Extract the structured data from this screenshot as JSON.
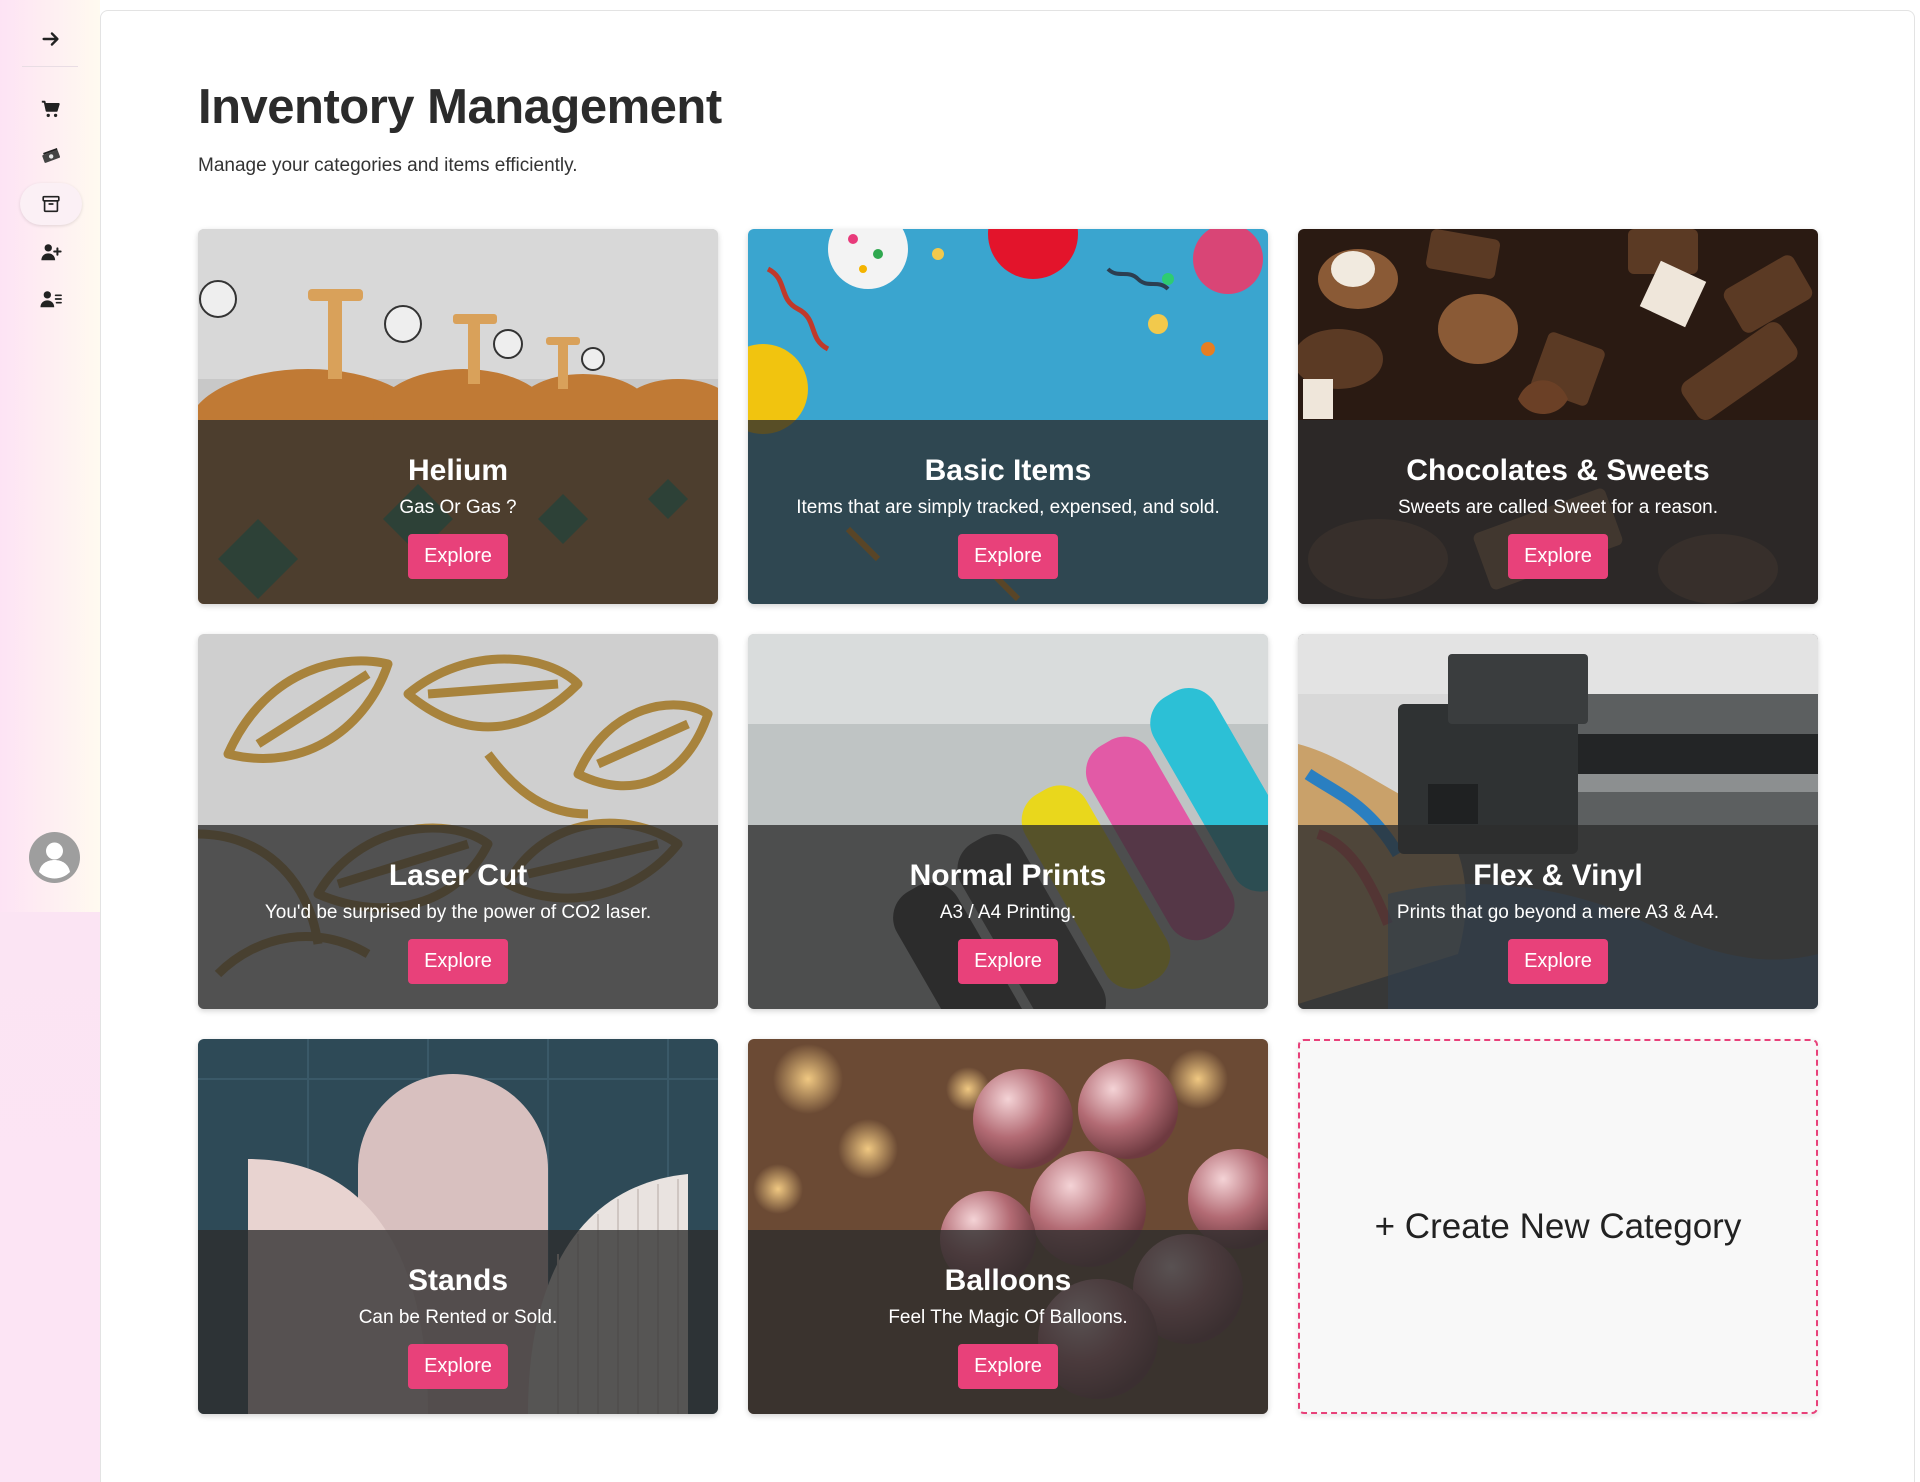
{
  "sidebar": {
    "items": [
      {
        "icon": "arrow-right-icon",
        "name": "expand"
      },
      {
        "icon": "cart-icon",
        "name": "cart"
      },
      {
        "icon": "money-icon",
        "name": "money"
      },
      {
        "icon": "archive-icon",
        "name": "inventory",
        "active": true
      },
      {
        "icon": "user-plus-icon",
        "name": "add-user"
      },
      {
        "icon": "user-list-icon",
        "name": "user-list"
      }
    ],
    "avatar_icon": "user-avatar-icon"
  },
  "page": {
    "title": "Inventory Management",
    "subtitle": "Manage your categories and items efficiently."
  },
  "categories": [
    {
      "title": "Helium",
      "description": "Gas Or Gas ?",
      "button": "Explore"
    },
    {
      "title": "Basic Items",
      "description": "Items that are simply tracked, expensed, and sold.",
      "button": "Explore"
    },
    {
      "title": "Chocolates & Sweets",
      "description": "Sweets are called Sweet for a reason.",
      "button": "Explore"
    },
    {
      "title": "Laser Cut",
      "description": "You'd be surprised by the power of CO2 laser.",
      "button": "Explore"
    },
    {
      "title": "Normal Prints",
      "description": "A3 / A4 Printing.",
      "button": "Explore"
    },
    {
      "title": "Flex & Vinyl",
      "description": "Prints that go beyond a mere A3 & A4.",
      "button": "Explore"
    },
    {
      "title": "Stands",
      "description": "Can be Rented or Sold.",
      "button": "Explore"
    },
    {
      "title": "Balloons",
      "description": "Feel The Magic Of Balloons.",
      "button": "Explore"
    }
  ],
  "create_card": {
    "label": "+ Create New Category"
  },
  "colors": {
    "accent": "#e8417a",
    "overlay": "#2d2d2d"
  }
}
